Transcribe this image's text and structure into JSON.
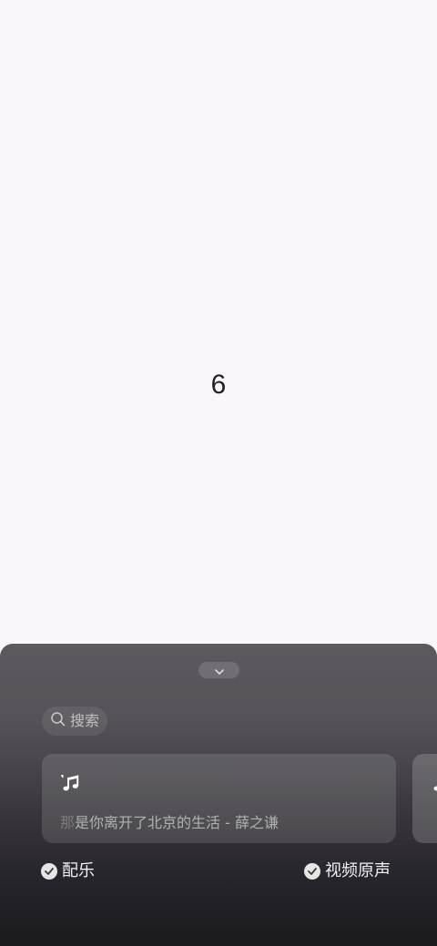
{
  "preview": {
    "number": "6"
  },
  "panel": {
    "search": {
      "label": "搜索",
      "icon": "search-icon"
    },
    "music_card": {
      "icon": "music-note-icon",
      "title_faded": "那",
      "title": "是你离开了北京的生活 - 薛之谦"
    },
    "options": {
      "music_label": "配乐",
      "original_sound_label": "视频原声"
    }
  }
}
